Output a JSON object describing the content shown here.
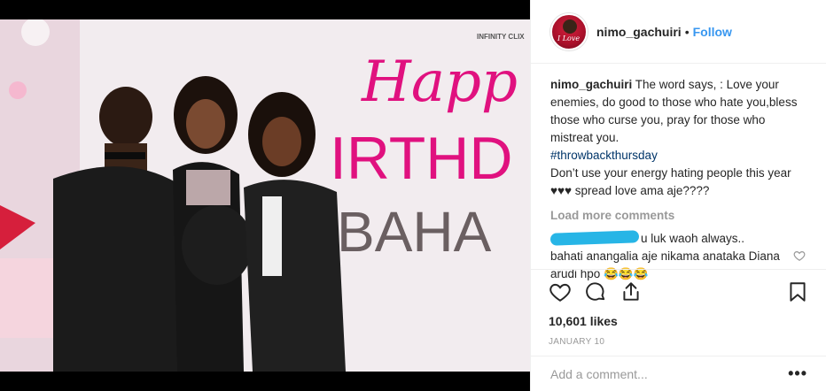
{
  "post": {
    "photo_watermark": "INFINITY CLIX",
    "banner_letters_1": "Happ",
    "banner_letters_2": "IRTHD",
    "banner_letters_3": "BAHA"
  },
  "header": {
    "username": "nimo_gachuiri",
    "separator": "•",
    "follow_label": "Follow",
    "avatar_text": "I Love"
  },
  "caption": {
    "username": "nimo_gachuiri",
    "text": "The word says, : Love your enemies, do good to those who hate you,bless those who curse you, pray for those who mistreat you.",
    "hashtag": "#throwbackthursday",
    "text2": "Don’t use your energy hating people this year ♥♥♥ spread love ama aje????"
  },
  "load_more_label": "Load more comments",
  "comments": [
    {
      "text": "u luk waoh always.."
    },
    {
      "text": "bahati anangalia aje nikama anataka Diana arudi hpo 😂😂😂"
    }
  ],
  "likes": "10,601 likes",
  "date": "JANUARY 10",
  "add_comment": {
    "placeholder": "Add a comment..."
  },
  "more_label": "•••",
  "colors": {
    "link": "#3897f0",
    "hashtag": "#003569",
    "redaction": "#27b5e6",
    "banner_pink": "#e0117f"
  },
  "icons": [
    "heart-icon",
    "comment-icon",
    "share-icon",
    "bookmark-icon",
    "more-icon"
  ]
}
